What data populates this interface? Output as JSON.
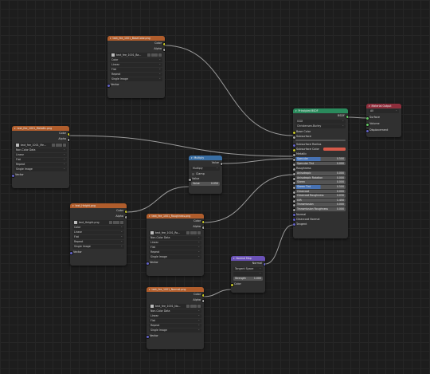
{
  "colors": {
    "texture_header": "#b05d2c",
    "converter_header": "#3a6fa4",
    "vector_header": "#6b52b8",
    "shader_header": "#2a8a5c",
    "output_header": "#8e2e3c",
    "link": "#9a9a9a"
  },
  "tex_basecolor": {
    "title": "text_fee_1001_BaseColor.png",
    "out_color": "Color",
    "out_alpha": "Alpha",
    "image_name": "text_fee_1001_Ba...",
    "colorspace": "Color",
    "interpolation": "Linear",
    "projection": "Flat",
    "extension": "Repeat",
    "source": "Single Image",
    "vector": "Vector"
  },
  "tex_metallic": {
    "title": "text_fee_1001_Metallic.png",
    "out_color": "Color",
    "out_alpha": "Alpha",
    "image_name": "text_fee_1001_Me...",
    "colorspace": "Non-Color Data",
    "interpolation": "Linear",
    "projection": "Flat",
    "extension": "Repeat",
    "source": "Single Image",
    "vector": "Vector"
  },
  "tex_height": {
    "title": "text_Height.png",
    "out_color": "Color",
    "out_alpha": "Alpha",
    "image_name": "text_Height.png",
    "colorspace": "Color",
    "interpolation": "Linear",
    "projection": "Flat",
    "extension": "Repeat",
    "source": "Single Image",
    "vector": "Vector"
  },
  "tex_roughness": {
    "title": "text_fee_1001_Roughness.png",
    "out_color": "Color",
    "out_alpha": "Alpha",
    "image_name": "text_fee_1001_Ro...",
    "colorspace": "Non-Color Data",
    "interpolation": "Linear",
    "projection": "Flat",
    "extension": "Repeat",
    "source": "Single Image",
    "vector": "Vector"
  },
  "tex_normal": {
    "title": "text_fee_1001_Normal.png",
    "out_color": "Color",
    "out_alpha": "Alpha",
    "image_name": "text_fee_1001_No...",
    "colorspace": "Non-Color Data",
    "interpolation": "Linear",
    "projection": "Flat",
    "extension": "Repeat",
    "source": "Single Image",
    "vector": "Vector"
  },
  "math": {
    "title": "Multiply",
    "out_value": "Value",
    "operation": "Multiply",
    "clamp": "Clamp",
    "in_value": "Value",
    "value_label": "Value",
    "value": "0.050"
  },
  "normal_map": {
    "title": "Normal Map",
    "out_normal": "Normal",
    "space": "Tangent Space",
    "uv": "",
    "strength_label": "Strength",
    "strength": "1.000",
    "in_color": "Color"
  },
  "bsdf": {
    "title": "Principled BSDF",
    "out_bsdf": "BSDF",
    "distribution": "GGX",
    "subsurface_method": "Christensen-Burley",
    "rows": [
      {
        "label": "Base Color",
        "kind": "socket"
      },
      {
        "label": "Subsurface",
        "kind": "socket"
      },
      {
        "label": "Subsurface Radius",
        "kind": "socket"
      },
      {
        "label": "Subsurface Color",
        "kind": "color"
      },
      {
        "label": "Metallic",
        "kind": "socket"
      },
      {
        "label": "Specular",
        "value": "0.500",
        "fill": 0.5,
        "kind": "blue"
      },
      {
        "label": "Specular Tint",
        "value": "0.000",
        "fill": 0,
        "kind": "field"
      },
      {
        "label": "Roughness",
        "kind": "socket"
      },
      {
        "label": "Anisotropic",
        "value": "0.000",
        "fill": 0,
        "kind": "field"
      },
      {
        "label": "Anisotropic Rotation",
        "value": "0.000",
        "fill": 0,
        "kind": "field"
      },
      {
        "label": "Sheen",
        "value": "0.000",
        "fill": 0,
        "kind": "field"
      },
      {
        "label": "Sheen Tint",
        "value": "0.500",
        "fill": 0.5,
        "kind": "blue"
      },
      {
        "label": "Clearcoat",
        "value": "0.000",
        "fill": 0,
        "kind": "field"
      },
      {
        "label": "Clearcoat Roughness",
        "value": "0.030",
        "fill": 0.03,
        "kind": "field"
      },
      {
        "label": "IOR",
        "value": "1.450",
        "fill": 0,
        "kind": "field"
      },
      {
        "label": "Transmission",
        "value": "0.000",
        "fill": 0,
        "kind": "field"
      },
      {
        "label": "Transmission Roughness",
        "value": "0.000",
        "fill": 0,
        "kind": "field"
      },
      {
        "label": "Normal",
        "kind": "socket"
      },
      {
        "label": "Clearcoat Normal",
        "kind": "socket"
      },
      {
        "label": "Tangent",
        "kind": "socket"
      }
    ]
  },
  "output": {
    "title": "Material Output",
    "target": "All",
    "surface": "Surface",
    "volume": "Volume",
    "displacement": "Displacement"
  }
}
